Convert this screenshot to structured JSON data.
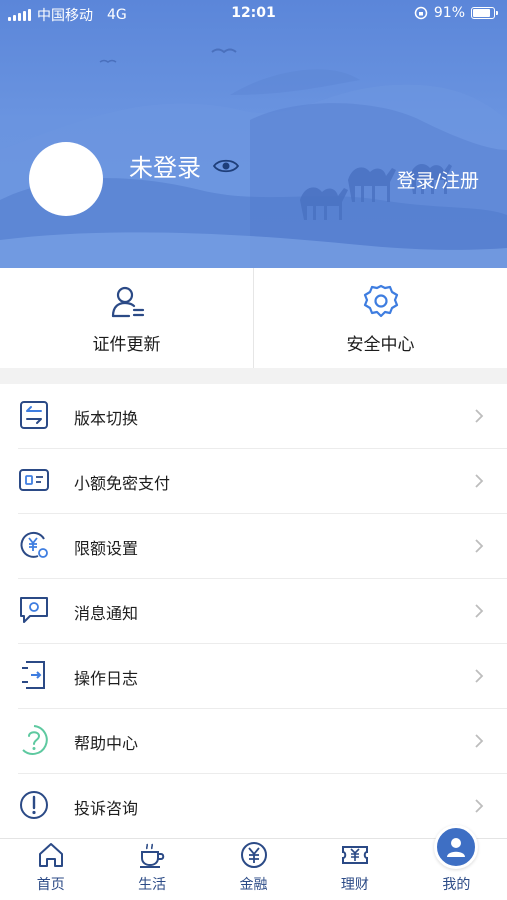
{
  "status_bar": {
    "carrier": "中国移动",
    "network": "4G",
    "time": "12:01",
    "battery": "91%",
    "battery_level": 0.91
  },
  "profile": {
    "login_status": "未登录",
    "login_link": "登录/注册"
  },
  "quick_actions": [
    {
      "label": "证件更新",
      "icon": "user-id-icon"
    },
    {
      "label": "安全中心",
      "icon": "gear-icon"
    }
  ],
  "menu": [
    {
      "label": "版本切换",
      "icon": "switch-icon"
    },
    {
      "label": "小额免密支付",
      "icon": "card-icon"
    },
    {
      "label": "限额设置",
      "icon": "yuan-settings-icon"
    },
    {
      "label": "消息通知",
      "icon": "message-icon"
    },
    {
      "label": "操作日志",
      "icon": "log-icon"
    },
    {
      "label": "帮助中心",
      "icon": "help-icon"
    },
    {
      "label": "投诉咨询",
      "icon": "alert-icon"
    }
  ],
  "tabbar": [
    {
      "label": "首页",
      "icon": "home-icon"
    },
    {
      "label": "生活",
      "icon": "cup-icon"
    },
    {
      "label": "金融",
      "icon": "yuan-coin-icon"
    },
    {
      "label": "理财",
      "icon": "ticket-icon"
    },
    {
      "label": "我的",
      "icon": "user-icon",
      "active": true
    }
  ],
  "colors": {
    "header_blue": "#5b86d9",
    "icon_navy": "#2b4a86",
    "accent_blue": "#3e6fc4",
    "help_green": "#5ec9a0"
  }
}
